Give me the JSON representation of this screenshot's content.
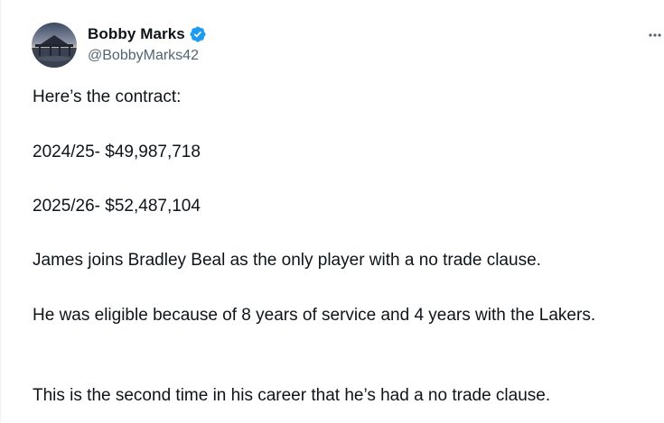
{
  "author": {
    "display_name": "Bobby Marks",
    "handle": "@BobbyMarks42",
    "verified": true,
    "verified_color": "#1d9bf0",
    "avatar_icon": "pier-at-sunset-avatar"
  },
  "menu": {
    "icon": "more-horizontal-icon"
  },
  "tweet": {
    "paragraphs": [
      "Here’s the contract:",
      "2024/25- $49,987,718",
      "2025/26- $52,487,104",
      "James joins Bradley Beal as the only player with a no trade clause.",
      "He was eligible because of 8 years of service and 4 years with the Lakers.",
      "This is the second time in his career that he’s had a no trade clause."
    ]
  }
}
